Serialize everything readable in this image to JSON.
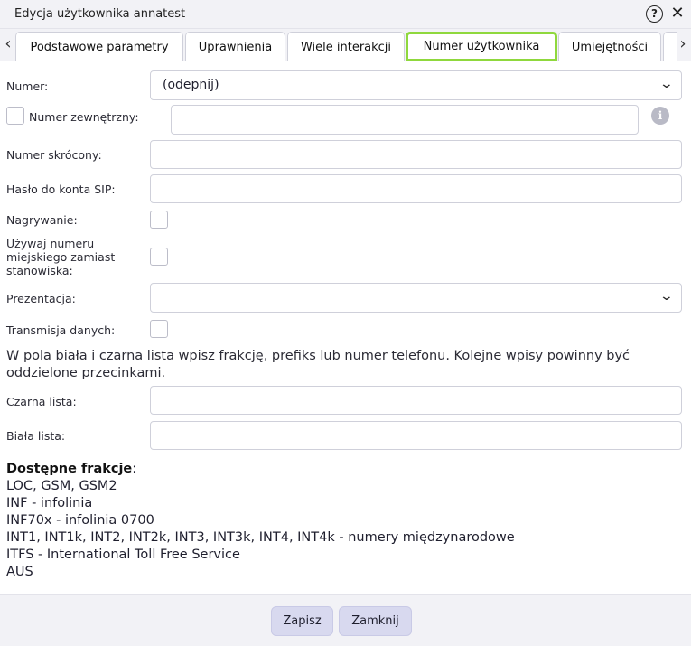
{
  "window": {
    "title": "Edycja użytkownika annatest",
    "help_icon": "?",
    "close_icon": "✕"
  },
  "tabs": {
    "prev_icon": "‹",
    "next_icon": "›",
    "items": [
      {
        "label": "Podstawowe parametry"
      },
      {
        "label": "Uprawnienia"
      },
      {
        "label": "Wiele interakcji"
      },
      {
        "label": "Numer użytkownika"
      },
      {
        "label": "Umiejętności"
      }
    ],
    "active_index": 3
  },
  "form": {
    "numer": {
      "label": "Numer:",
      "value": "(odepnij)"
    },
    "numer_zewnetrzny": {
      "label": "Numer zewnętrzny:",
      "checked": false,
      "value": "",
      "info_icon": "i"
    },
    "numer_skrocony": {
      "label": "Numer skrócony:",
      "value": ""
    },
    "haslo_sip": {
      "label": "Hasło do konta SIP:",
      "value": ""
    },
    "nagrywanie": {
      "label": "Nagrywanie:",
      "checked": false
    },
    "uzywaj_numeru": {
      "label": "Używaj numeru miejskiego zamiast stanowiska:",
      "checked": false
    },
    "prezentacja": {
      "label": "Prezentacja:",
      "value": ""
    },
    "transmisja": {
      "label": "Transmisja danych:",
      "checked": false
    },
    "note": "W pola biała i czarna lista wpisz frakcję, prefiks lub numer telefonu. Kolejne wpisy powinny być oddzielone przecinkami.",
    "czarna_lista": {
      "label": "Czarna lista:",
      "value": ""
    },
    "biala_lista": {
      "label": "Biała lista:",
      "value": ""
    }
  },
  "fractions": {
    "heading": "Dostępne frakcje",
    "colon": ":",
    "lines": [
      "LOC, GSM, GSM2",
      "INF - infolinia",
      "INF70x - infolinia 0700",
      "INT1, INT1k, INT2, INT2k, INT3, INT3k, INT4, INT4k - numery międzynarodowe",
      "ITFS - International Toll Free Service",
      "AUS"
    ]
  },
  "footer": {
    "save_label": "Zapisz",
    "close_label": "Zamknij"
  },
  "colors": {
    "active_tab_border": "#8fd83d",
    "button_bg": "#d8d9ef"
  }
}
